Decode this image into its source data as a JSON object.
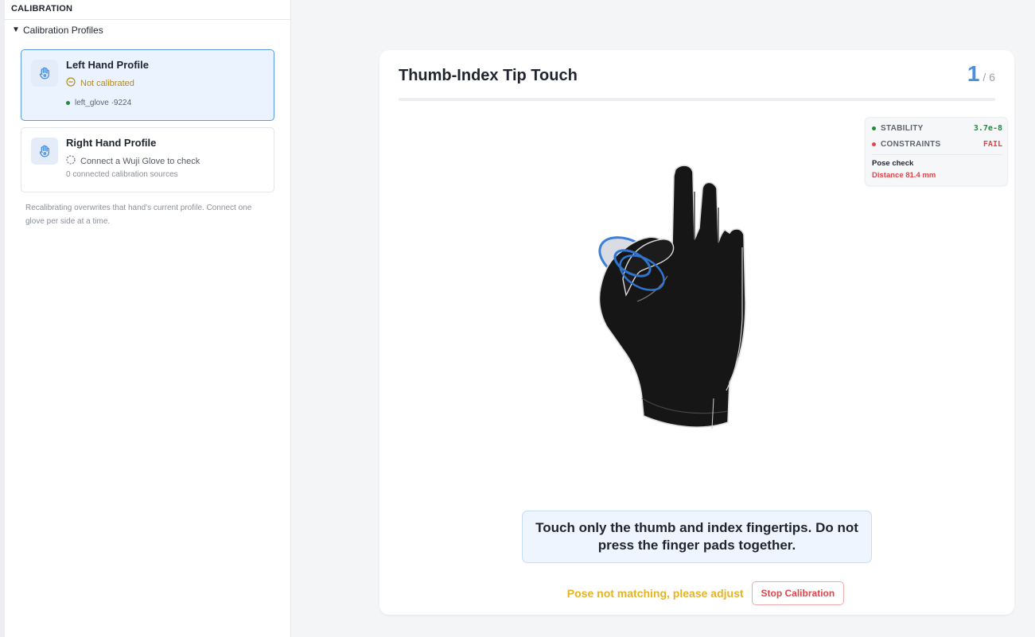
{
  "sidebar": {
    "header": "CALIBRATION",
    "section_caret": "▼",
    "section_title": "Calibration Profiles",
    "profiles": [
      {
        "title": "Left Hand Profile",
        "status": "Not calibrated",
        "status_icon": "minus-circle-icon",
        "source": "left_glove ·9224",
        "active": true
      },
      {
        "title": "Right Hand Profile",
        "status": "Connect a Wuji Glove to check",
        "status_icon": "dashed-circle-icon",
        "source": "0 connected calibration sources",
        "active": false
      }
    ],
    "note": "Recalibrating overwrites that hand's current profile. Connect one glove per side at a time."
  },
  "step": {
    "title": "Thumb-Index Tip Touch",
    "current": "1",
    "total": "/ 6",
    "progress": 0
  },
  "metrics": {
    "stability_label": "STABILITY",
    "stability_value": "3.7e-8",
    "constraints_label": "CONSTRAINTS",
    "constraints_value": "FAIL",
    "pose_check_label": "Pose check",
    "pose_check_value": "Distance 81.4 mm"
  },
  "instruction": "Touch only the thumb and index fingertips. Do not press the finger pads together.",
  "status_message": "Pose not matching, please adjust",
  "stop_button_label": "Stop Calibration",
  "colors": {
    "accent": "#4a90e2",
    "warn": "#e6b422",
    "danger": "#e0454a",
    "ok": "#1f8a3b"
  }
}
